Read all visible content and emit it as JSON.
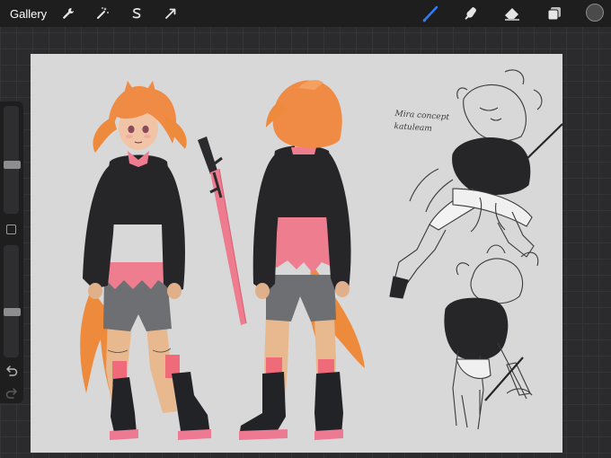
{
  "topbar": {
    "gallery_label": "Gallery",
    "actions": [
      "wrench-icon",
      "magic-wand-icon",
      "selection-s-icon",
      "transform-arrow-icon"
    ],
    "tools": [
      "brush-icon",
      "smudge-icon",
      "eraser-icon",
      "layers-icon"
    ],
    "active_tool": "brush",
    "brush_color": "#4a4a4a",
    "accent_color": "#2f7df6"
  },
  "sidebar": {
    "brush_size_level": 0.45,
    "opacity_level": 0.4,
    "controls": [
      "modify-button",
      "undo-icon",
      "redo-icon"
    ]
  },
  "canvas": {
    "background": "#d8d8d8",
    "note_line1": "Mira concept",
    "note_line2": "katuleam"
  }
}
